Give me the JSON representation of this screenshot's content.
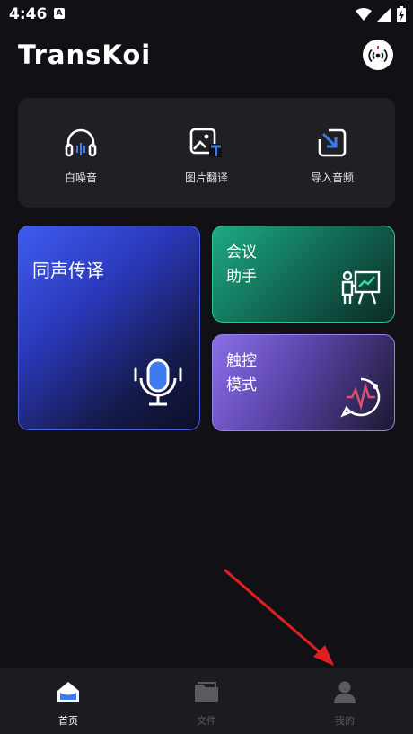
{
  "status_bar": {
    "time": "4:46",
    "notif_icon": "A"
  },
  "header": {
    "logo": "TransKoi",
    "radio_icon": "broadcast-icon"
  },
  "tools": [
    {
      "label": "白噪音",
      "icon": "headphones-icon"
    },
    {
      "label": "图片翻译",
      "icon": "image-translate-icon"
    },
    {
      "label": "导入音频",
      "icon": "import-audio-icon"
    }
  ],
  "cards": {
    "simultaneous": {
      "title": "同声传译",
      "icon": "microphone-icon"
    },
    "meeting": {
      "title": "会议\n助手",
      "line1": "会议",
      "line2": "助手",
      "icon": "presentation-icon"
    },
    "touch": {
      "title": "触控\n模式",
      "line1": "触控",
      "line2": "模式",
      "icon": "waveform-chat-icon"
    }
  },
  "nav": [
    {
      "label": "首页",
      "active": true
    },
    {
      "label": "文件",
      "active": false
    },
    {
      "label": "我的",
      "active": false
    }
  ],
  "colors": {
    "background": "#111115",
    "annotation_arrow": "#e02020"
  }
}
